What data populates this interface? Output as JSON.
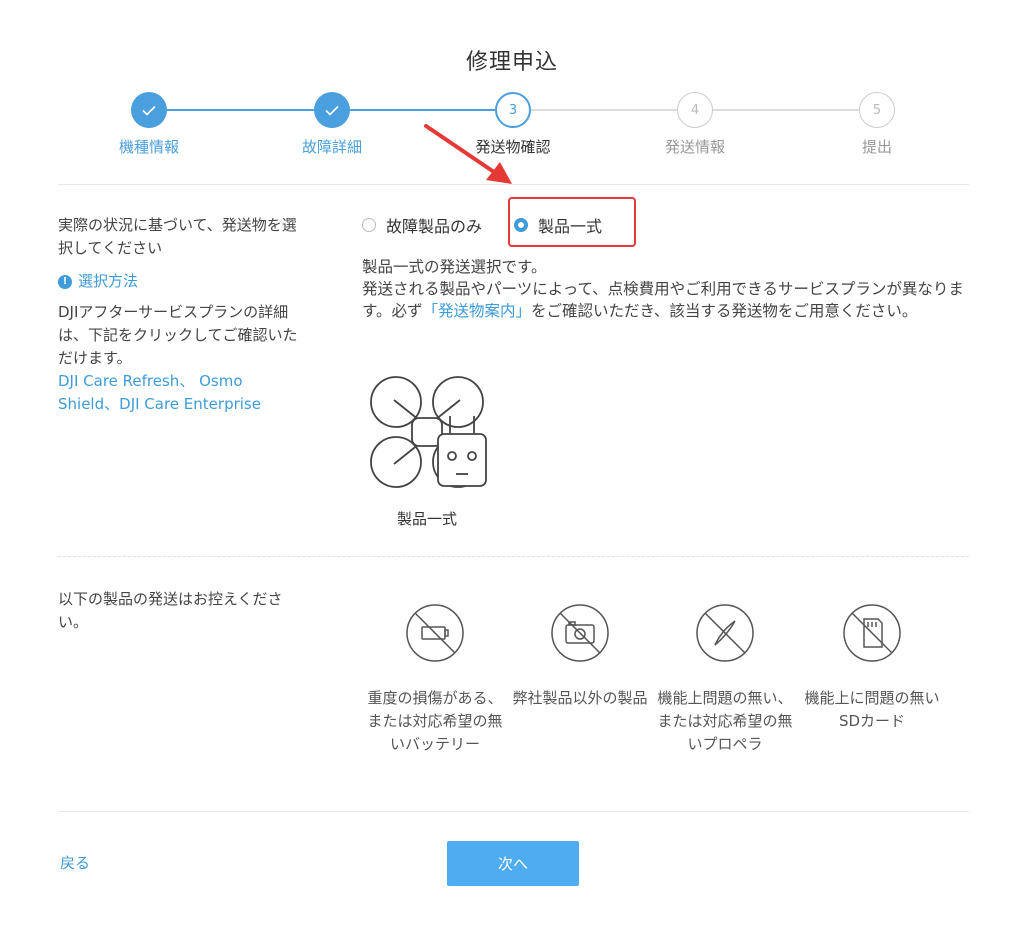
{
  "title": "修理申込",
  "steps": [
    {
      "number": "1",
      "label": "機種情報",
      "state": "done"
    },
    {
      "number": "2",
      "label": "故障詳細",
      "state": "done"
    },
    {
      "number": "3",
      "label": "発送物確認",
      "state": "active"
    },
    {
      "number": "4",
      "label": "発送情報",
      "state": "todo"
    },
    {
      "number": "5",
      "label": "提出",
      "state": "todo"
    }
  ],
  "left_panel": {
    "instruction": "実際の状況に基づいて、発送物を選択してください",
    "select_method_link": "選択方法",
    "plan_text": "DJIアフターサービスプランの詳細は、下記をクリックしてご確認いただけます。",
    "plan_links": {
      "care_refresh": "DJI Care Refresh",
      "separator_1": "、",
      "osmo_shield": "Osmo Shield",
      "separator_2": "、",
      "care_enterprise": "DJI Care Enterprise"
    }
  },
  "options": {
    "faulty_only": "故障製品のみ",
    "full_set": "製品一式",
    "selected": "full_set"
  },
  "description": {
    "line1": "製品一式の発送選択です。",
    "line2_before": "発送される製品やパーツによって、点検費用やご利用できるサービスプランが異なります。必ず",
    "line2_link": "「発送物案内」",
    "line2_after": "をご確認いただき、該当する発送物をご用意ください。"
  },
  "product_label": "製品一式",
  "restrictions": {
    "heading": "以下の製品の発送はお控えください。",
    "items": [
      {
        "icon": "no-battery-icon",
        "label": "重度の損傷がある、または対応希望の無いバッテリー"
      },
      {
        "icon": "no-camera-icon",
        "label": "弊社製品以外の製品"
      },
      {
        "icon": "no-propeller-icon",
        "label": "機能上問題の無い、または対応希望の無いプロペラ"
      },
      {
        "icon": "no-sd-card-icon",
        "label": "機能上に問題の無いSDカード"
      }
    ]
  },
  "footer": {
    "back_label": "戻る",
    "next_label": "次へ"
  },
  "colors": {
    "accent": "#4a9fde",
    "highlight": "#e53935"
  }
}
